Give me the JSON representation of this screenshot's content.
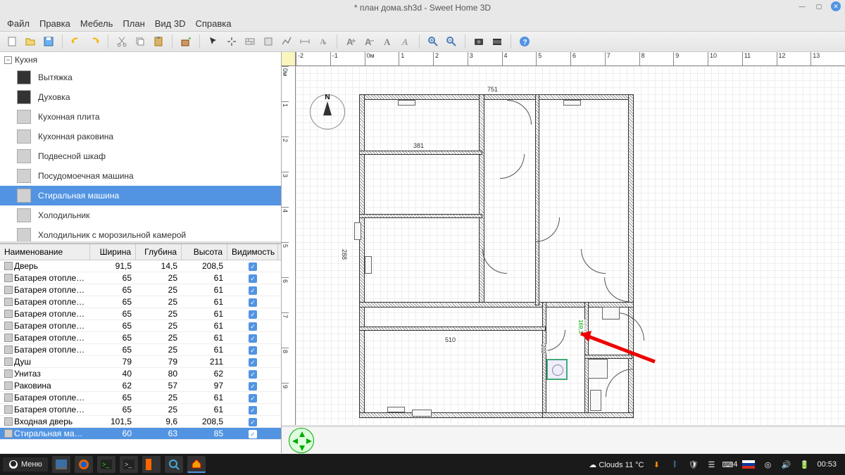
{
  "titlebar": {
    "title": "* план дома.sh3d - Sweet Home 3D"
  },
  "menubar": [
    "Файл",
    "Правка",
    "Мебель",
    "План",
    "Вид 3D",
    "Справка"
  ],
  "toolbar_icons": [
    "new",
    "open",
    "save",
    "undo",
    "redo",
    "cut",
    "copy",
    "paste",
    "add-furniture",
    "select",
    "pan",
    "wall",
    "room",
    "polyline",
    "dimension",
    "text",
    "compass",
    "level",
    "3d-top",
    "3d-obs",
    "zoom-in",
    "zoom-out",
    "photo",
    "video",
    "help"
  ],
  "catalog": {
    "category": "Кухня",
    "items": [
      {
        "label": "Вытяжка",
        "dark": true
      },
      {
        "label": "Духовка",
        "dark": true
      },
      {
        "label": "Кухонная плита",
        "dark": false
      },
      {
        "label": "Кухонная раковина",
        "dark": false
      },
      {
        "label": "Подвесной шкаф",
        "dark": false
      },
      {
        "label": "Посудомоечная машина",
        "dark": false
      },
      {
        "label": "Стиральная машина",
        "dark": false,
        "selected": true
      },
      {
        "label": "Холодильник",
        "dark": false
      },
      {
        "label": "Холодильник с морозильной камерой",
        "dark": false
      }
    ]
  },
  "furniture_table": {
    "headers": {
      "name": "Наименование",
      "width": "Ширина",
      "depth": "Глубина",
      "height": "Высота",
      "vis": "Видимость"
    },
    "rows": [
      {
        "name": "Дверь",
        "w": "91,5",
        "d": "14,5",
        "h": "208,5",
        "v": true
      },
      {
        "name": "Батарея отопле…",
        "w": "65",
        "d": "25",
        "h": "61",
        "v": true
      },
      {
        "name": "Батарея отопле…",
        "w": "65",
        "d": "25",
        "h": "61",
        "v": true
      },
      {
        "name": "Батарея отопле…",
        "w": "65",
        "d": "25",
        "h": "61",
        "v": true
      },
      {
        "name": "Батарея отопле…",
        "w": "65",
        "d": "25",
        "h": "61",
        "v": true
      },
      {
        "name": "Батарея отопле…",
        "w": "65",
        "d": "25",
        "h": "61",
        "v": true
      },
      {
        "name": "Батарея отопле…",
        "w": "65",
        "d": "25",
        "h": "61",
        "v": true
      },
      {
        "name": "Батарея отопле…",
        "w": "65",
        "d": "25",
        "h": "61",
        "v": true
      },
      {
        "name": "Душ",
        "w": "79",
        "d": "79",
        "h": "211",
        "v": true
      },
      {
        "name": "Унитаз",
        "w": "40",
        "d": "80",
        "h": "62",
        "v": true
      },
      {
        "name": "Раковина",
        "w": "62",
        "d": "57",
        "h": "97",
        "v": true
      },
      {
        "name": "Батарея отопле…",
        "w": "65",
        "d": "25",
        "h": "61",
        "v": true
      },
      {
        "name": "Батарея отопле…",
        "w": "65",
        "d": "25",
        "h": "61",
        "v": true
      },
      {
        "name": "Входная дверь",
        "w": "101,5",
        "d": "9,6",
        "h": "208,5",
        "v": true
      },
      {
        "name": "Стиральная ма…",
        "w": "60",
        "d": "63",
        "h": "85",
        "v": true,
        "selected": true
      }
    ]
  },
  "ruler_h": [
    "-2",
    "-1",
    "0м",
    "1",
    "2",
    "3",
    "4",
    "5",
    "6",
    "7",
    "8",
    "9",
    "10",
    "11",
    "12",
    "13"
  ],
  "ruler_v": [
    "0м",
    "1",
    "2",
    "3",
    "4",
    "5",
    "6",
    "7",
    "8",
    "9"
  ],
  "plan_dims": {
    "d1": "751",
    "d2": "381",
    "d3": "288",
    "d4": "510",
    "d5": "202",
    "d6": "169,3"
  },
  "taskbar": {
    "menu": "Меню",
    "weather": "Clouds 11 °C",
    "keyboard": "4",
    "clock": "00:53"
  }
}
